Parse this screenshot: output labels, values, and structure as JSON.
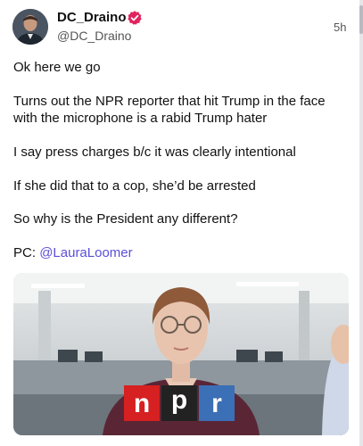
{
  "post": {
    "author": {
      "display_name": "DC_Draino",
      "handle": "@DC_Draino",
      "verified": true,
      "verified_color": "#e0245e"
    },
    "timestamp": "5h",
    "body": {
      "line1": "Ok here we go",
      "line2a": "Turns out the NPR reporter that hit Trump in the face",
      "line2b": "with the microphone is a rabid Trump hater",
      "line3": "I say press charges b/c it was clearly intentional",
      "line4": "If she did that to a cop, she’d be arrested",
      "line5": "So why is the President any different?",
      "credit_prefix": "PC: ",
      "credit_mention": "@LauraLoomer"
    },
    "media": {
      "logo_letters": [
        "n",
        "p",
        "r"
      ],
      "logo_colors": [
        "#d62021",
        "#222222",
        "#3b6fb6"
      ]
    },
    "accent_color": "#5b4fd9"
  }
}
